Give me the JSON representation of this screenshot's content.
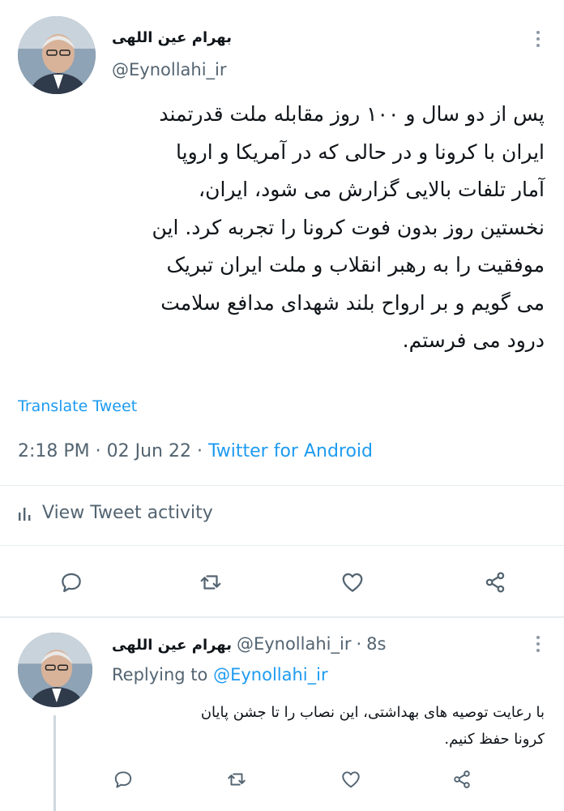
{
  "main_tweet": {
    "author_name": "بهرام عین اللهی",
    "handle": "@Eynollahi_ir",
    "text_lines": [
      "پس از دو سال و ۱۰۰ روز مقابله ملت قدرتمند",
      "ایران با کرونا و در حالی که در آمریکا و اروپا",
      "آمار تلفات بالایی گزارش می شود، ایران،",
      "نخستین روز بدون فوت کرونا  را تجربه کرد. این",
      "موفقیت را به رهبر انقلاب و ملت ایران تبریک",
      "می گویم و بر ارواح بلند شهدای مدافع سلامت",
      "درود می فرستم."
    ],
    "translate_label": "Translate Tweet",
    "time": "2:18 PM",
    "separator": " · ",
    "date": "02 Jun 22",
    "source": "Twitter for Android",
    "activity_label": "View Tweet activity"
  },
  "reply_tweet": {
    "author_name": "بهرام عین اللهی",
    "handle": "@Eynollahi_ir",
    "dot": "·",
    "age": "8s",
    "replying_prefix": "Replying to",
    "replying_to": "@Eynollahi_ir",
    "text_lines": [
      "با رعایت توصیه های بهداشتی، این نصاب را تا جشن پایان",
      "کرونا حفظ کنیم."
    ]
  },
  "icons": [
    "reply-icon",
    "retweet-icon",
    "like-icon",
    "share-icon",
    "more-icon",
    "analytics-icon"
  ],
  "colors": {
    "link": "#1d9bf0",
    "secondary": "#536471",
    "text": "#0f1419",
    "divider": "#e6ecf0"
  }
}
